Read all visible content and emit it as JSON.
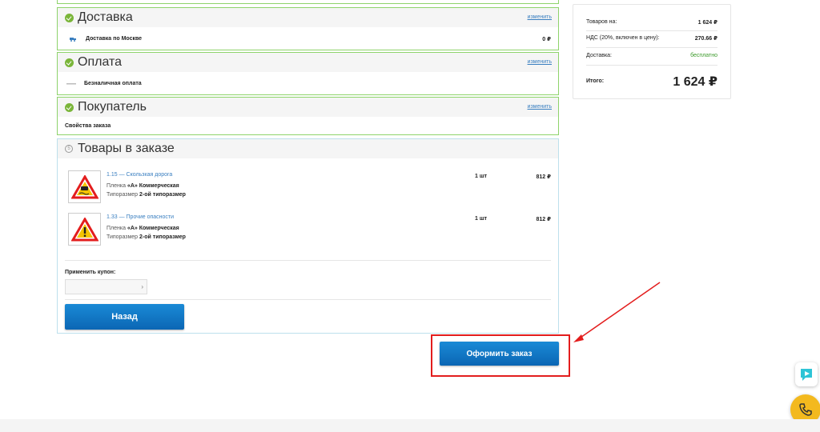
{
  "sections": {
    "delivery": {
      "title": "Доставка",
      "change": "изменить",
      "item": "Доставка по Москве",
      "price": "0 ₽"
    },
    "payment": {
      "title": "Оплата",
      "change": "изменить",
      "item": "Безналичная оплата"
    },
    "buyer": {
      "title": "Покупатель",
      "change": "изменить",
      "item": "Свойства заказа"
    },
    "goods": {
      "title": "Товары в заказе",
      "items": [
        {
          "name": "1.15 — Скользкая дорога",
          "film_label": "Пленка",
          "film_value": "«А» Коммерческая",
          "size_label": "Типоразмер",
          "size_value": "2-ой типоразмер",
          "qty": "1 шт",
          "price": "812 ₽",
          "icon": "slippery-road-sign-icon"
        },
        {
          "name": "1.33 — Прочие опасности",
          "film_label": "Пленка",
          "film_value": "«А» Коммерческая",
          "size_label": "Типоразмер",
          "size_value": "2-ой типоразмер",
          "qty": "1 шт",
          "price": "812 ₽",
          "icon": "other-dangers-sign-icon"
        }
      ],
      "coupon_label": "Применить купон:",
      "coupon_value": "",
      "back_label": "Назад"
    }
  },
  "summary": {
    "goods_label": "Товаров на:",
    "goods_value": "1 624 ₽",
    "vat_label": "НДС (20%, включен в цену):",
    "vat_value": "270.66 ₽",
    "delivery_label": "Доставка:",
    "delivery_value": "бесплатно",
    "total_label": "Итого:",
    "total_value": "1 624 ₽"
  },
  "order_button": "Оформить заказ",
  "colors": {
    "accent": "#0b66b4",
    "success": "#8ed36b",
    "highlight": "#e31d1d",
    "call": "#f3b91e"
  }
}
